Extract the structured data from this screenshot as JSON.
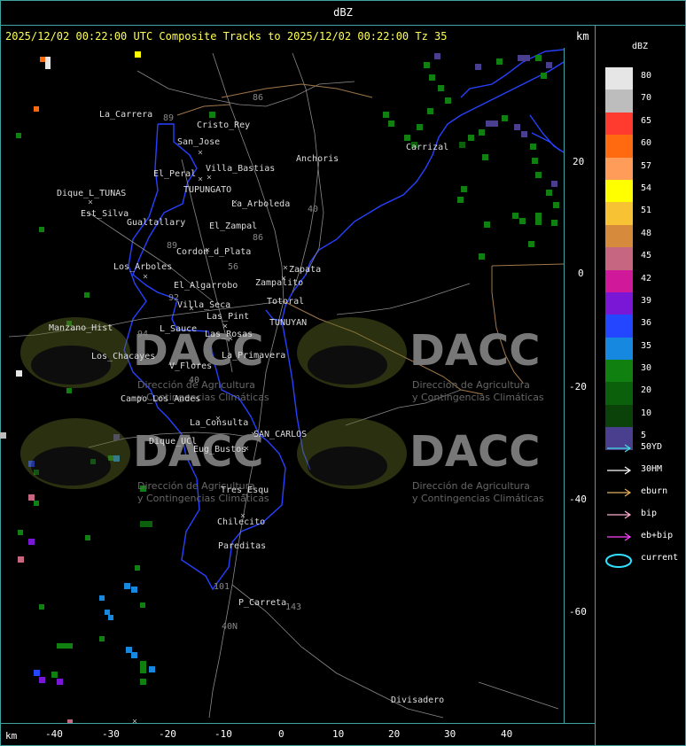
{
  "header": {
    "title": "dBZ"
  },
  "track_title": "2025/12/02 00:22:00 UTC Composite Tracks to 2025/12/02 00:22:00 Tz 35",
  "units": {
    "top": "km",
    "bottom": "km"
  },
  "legend": {
    "title": "dBZ",
    "levels": [
      {
        "label": "80",
        "color": "#e6e6e6"
      },
      {
        "label": "70",
        "color": "#bdbdbd"
      },
      {
        "label": "65",
        "color": "#ff3b2f"
      },
      {
        "label": "60",
        "color": "#ff6a10"
      },
      {
        "label": "57",
        "color": "#ff9c5a"
      },
      {
        "label": "54",
        "color": "#ffff00"
      },
      {
        "label": "51",
        "color": "#f7c233"
      },
      {
        "label": "48",
        "color": "#d58a3c"
      },
      {
        "label": "45",
        "color": "#c76680"
      },
      {
        "label": "42",
        "color": "#d0189a"
      },
      {
        "label": "39",
        "color": "#7a16d6"
      },
      {
        "label": "36",
        "color": "#2446ff"
      },
      {
        "label": "35",
        "color": "#1688e0"
      },
      {
        "label": "30",
        "color": "#108010"
      },
      {
        "label": "20",
        "color": "#0b600b"
      },
      {
        "label": "10",
        "color": "#0a420a"
      },
      {
        "label": "5",
        "color": "#4a3e8e"
      }
    ]
  },
  "tracks": [
    {
      "label": "50YD",
      "color": "#40e0e0"
    },
    {
      "label": "30HM",
      "color": "#ffffff"
    },
    {
      "label": "eburn",
      "color": "#e8b060"
    },
    {
      "label": "bip",
      "color": "#ffb0d0"
    },
    {
      "label": "eb+bip",
      "color": "#ff40ff"
    },
    {
      "label": "current",
      "color": "#30e0ff"
    }
  ],
  "x_ticks": [
    "-40",
    "-30",
    "-20",
    "-10",
    "0",
    "10",
    "20",
    "30",
    "40"
  ],
  "y_ticks": [
    "20",
    "0",
    "-20",
    "-40",
    "-60"
  ],
  "places": [
    "La_Carrera",
    "Cristo_Rey",
    "San_Jose",
    "El_Peral",
    "Villa_Bastias",
    "Anchoris",
    "Carrizal",
    "Dique_L_TUNAS",
    "TUPUNGATO",
    "Est_Silva",
    "La_Arboleda",
    "Gualtallary",
    "El_Zampal",
    "Cordon_d_Plata",
    "Los_Arboles",
    "Zapata",
    "El_Algarrobo",
    "Zampalito",
    "Totoral",
    "Villa_Seca",
    "Las_Pint",
    "TUNUYAN",
    "Manzano_Hist",
    "L_Sauce",
    "Las_Rosas",
    "Los_Chacayes",
    "La_Primavera",
    "V_Flores",
    "Campo_Los_Andes",
    "La_Consulta",
    "SAN_CARLOS",
    "Dique_UCl",
    "Eug_Bustos",
    "Tres_Esqu",
    "Chilecito",
    "Pareditas",
    "P_Carreta",
    "Divisadero"
  ],
  "road_labels": [
    "86",
    "89",
    "40",
    "86",
    "89",
    "56",
    "92",
    "94",
    "40",
    "101",
    "40N",
    "143"
  ],
  "watermark": {
    "name": "DACC",
    "line1": "Dirección de Agricultura",
    "line2": "y Contingencias Climáticas",
    "url": "http://www.contingencias.mendoza.gov.ar"
  }
}
